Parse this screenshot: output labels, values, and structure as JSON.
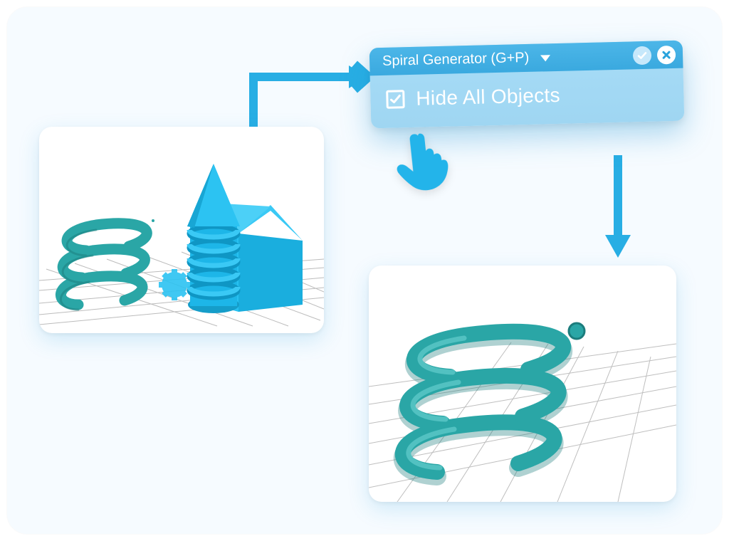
{
  "dialog": {
    "title": "Spiral Generator (G+P)",
    "checkbox_label": "Hide All Objects",
    "checkbox_checked": true
  },
  "colors": {
    "arrow": "#28aee4",
    "spiral": "#2aa6a6",
    "shapes": "#21b8ea",
    "hand": "#23b4ea"
  },
  "icons": {
    "confirm": "check-icon",
    "close": "close-icon",
    "dropdown": "chevron-down-icon",
    "pointer": "pointing-hand-icon"
  }
}
